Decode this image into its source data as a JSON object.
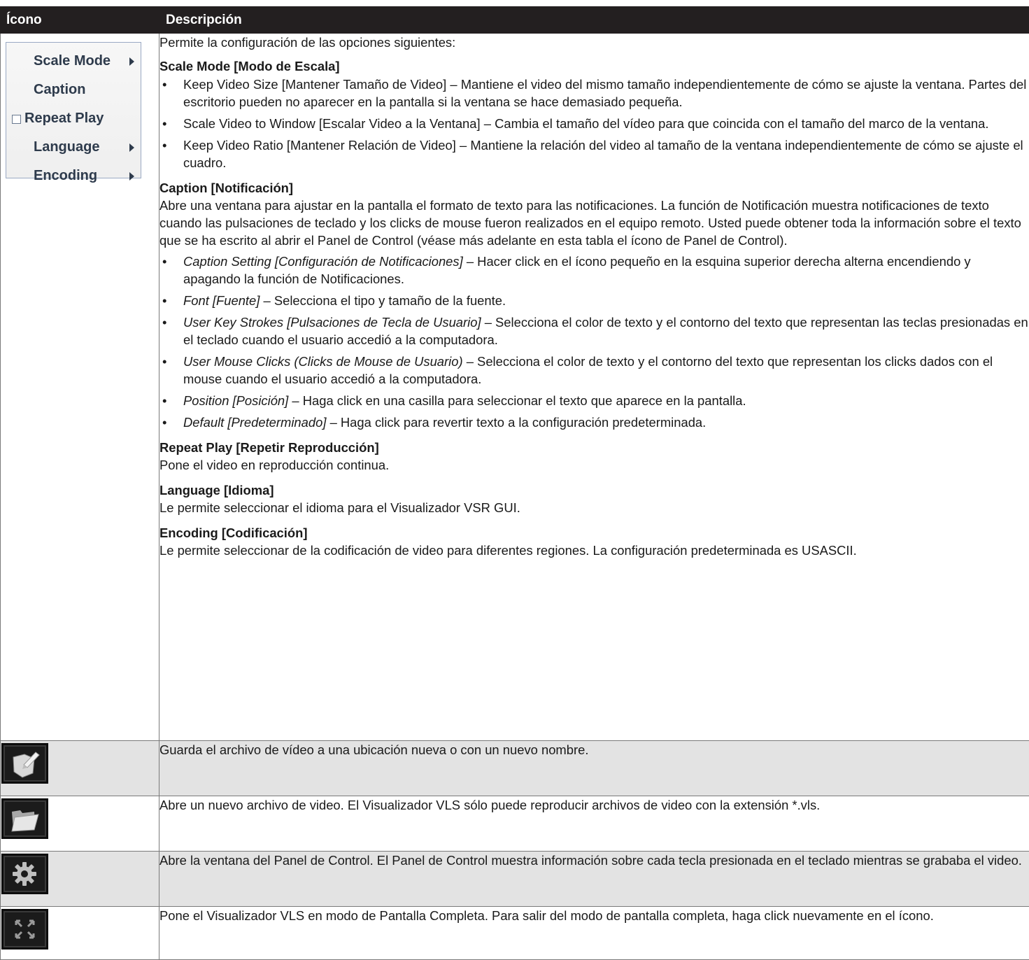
{
  "header": {
    "col1": "Ícono",
    "col2": "Descripción"
  },
  "menu": {
    "items": [
      {
        "label": "Scale Mode",
        "submenu": true,
        "checkbox": false
      },
      {
        "label": "Caption",
        "submenu": false,
        "checkbox": false
      },
      {
        "label": "Repeat Play",
        "submenu": false,
        "checkbox": true
      },
      {
        "label": "Language",
        "submenu": true,
        "checkbox": false
      },
      {
        "label": "Encoding",
        "submenu": true,
        "checkbox": false
      }
    ]
  },
  "row1": {
    "intro": "Permite la configuración de las opciones siguientes:",
    "scale": {
      "title": "Scale Mode [Modo de Escala]",
      "bullets": [
        "Keep Video Size [Mantener Tamaño de Video] – Mantiene el video del mismo tamaño independientemente de cómo se ajuste la ventana. Partes del escritorio pueden no aparecer en la pantalla si la ventana se hace demasiado pequeña.",
        "Scale Video to Window [Escalar Video a la Ventana] – Cambia el tamaño del vídeo para que coincida con el tamaño del marco de la ventana.",
        "Keep Video Ratio [Mantener Relación de Video] – Mantiene la relación del video al tamaño de la ventana independientemente de cómo se ajuste el cuadro."
      ]
    },
    "caption": {
      "title": "Caption [Notificación]",
      "text": "Abre una ventana para ajustar en la pantalla el formato de texto para las notificaciones. La función de Notificación muestra notificaciones de texto cuando las pulsaciones de teclado y los clicks de mouse fueron realizados en el equipo remoto. Usted puede obtener toda la información sobre el texto que se ha escrito al abrir el Panel de Control (véase más adelante en esta tabla el ícono de  Panel de Control).",
      "bullets": [
        {
          "term": "Caption Setting [Configuración de Notificaciones]",
          "rest": " – Hacer click en el ícono pequeño en la esquina superior derecha alterna encendiendo y apagando la función de Notificaciones."
        },
        {
          "term": "Font [Fuente]",
          "rest": " – Selecciona el tipo y tamaño de la fuente."
        },
        {
          "term": "User Key Strokes [Pulsaciones de Tecla de Usuario]",
          "rest": " – Selecciona el color de texto y el contorno del texto que representan las teclas presionadas en el teclado cuando el usuario accedió a la computadora."
        },
        {
          "term": "User Mouse Clicks (Clicks de Mouse de Usuario)",
          "rest": " – Selecciona el color de texto y el contorno del texto que representan los clicks dados con el mouse cuando el usuario accedió a la computadora."
        },
        {
          "term": "Position [Posición]",
          "rest": " – Haga click en una casilla para seleccionar el texto que aparece en la pantalla."
        },
        {
          "term": "Default [Predeterminado]",
          "rest": " – Haga click para revertir texto a la configuración predeterminada."
        }
      ]
    },
    "repeat": {
      "title": "Repeat Play [Repetir Reproducción]",
      "text": "Pone el video en reproducción continua."
    },
    "language": {
      "title": "Language [Idioma]",
      "text": "Le permite seleccionar el idioma para el Visualizador VSR GUI."
    },
    "encoding": {
      "title": "Encoding [Codificación]",
      "text": "Le permite seleccionar de la codificación de video para diferentes regiones. La configuración predeterminada es USASCII."
    }
  },
  "rows": [
    {
      "icon": "save-as-icon",
      "text": "Guarda el archivo de vídeo a una ubicación nueva o con un nuevo nombre."
    },
    {
      "icon": "open-folder-icon",
      "text": "Abre un nuevo archivo de video. El Visualizador VLS sólo puede reproducir archivos de video con la extensión *.vls."
    },
    {
      "icon": "gear-icon",
      "text": "Abre la ventana del Panel de Control. El Panel de Control muestra información sobre cada tecla presionada en el teclado mientras se grababa el video."
    },
    {
      "icon": "fullscreen-icon",
      "text": "Pone el Visualizador VLS en modo de Pantalla Completa. Para salir del modo de pantalla completa, haga click nuevamente en el ícono."
    }
  ],
  "colors": {
    "header_bg": "#231f20",
    "row_gray": "#e3e3e3",
    "border": "#7a7a7a"
  }
}
